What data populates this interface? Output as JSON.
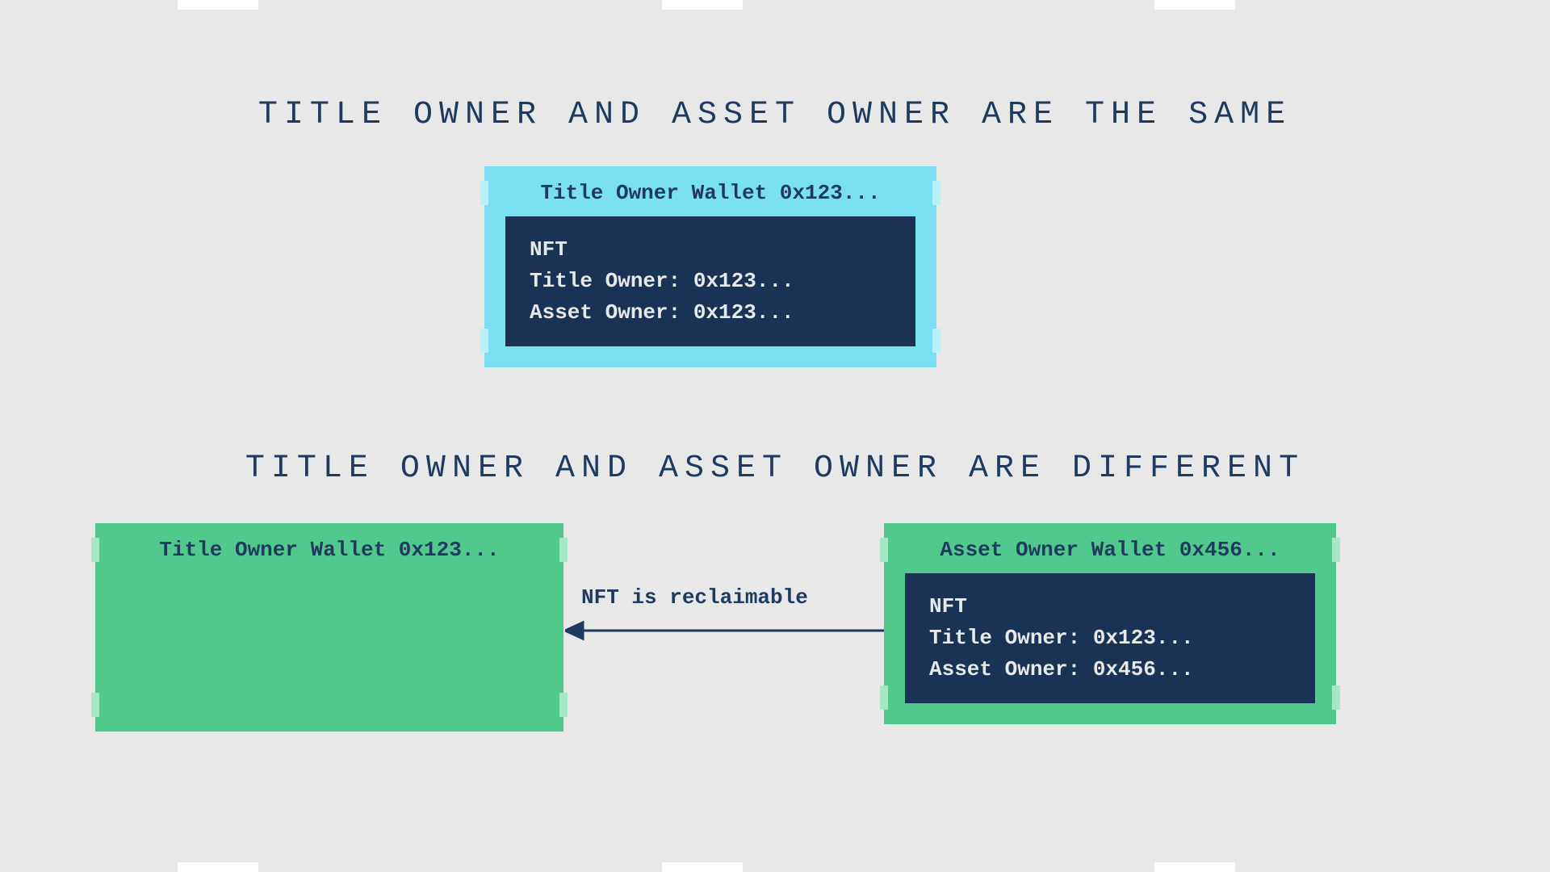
{
  "section1": {
    "heading": "TITLE OWNER AND ASSET OWNER ARE THE SAME",
    "wallet": {
      "label": "Title Owner Wallet 0x123...",
      "bg": "#7bdff2",
      "tick": "#b8f0fa",
      "nft": {
        "title": "NFT",
        "line1": "Title Owner: 0x123...",
        "line2": "Asset Owner: 0x123..."
      }
    }
  },
  "section2": {
    "heading": "TITLE OWNER AND ASSET OWNER ARE DIFFERENT",
    "walletLeft": {
      "label": "Title Owner Wallet 0x123...",
      "bg": "#52c98c",
      "tick": "#a6e8c5"
    },
    "walletRight": {
      "label": "Asset Owner Wallet 0x456...",
      "bg": "#52c98c",
      "tick": "#a6e8c5",
      "nft": {
        "title": "NFT",
        "line1": "Title Owner: 0x123...",
        "line2": "Asset Owner: 0x456..."
      }
    },
    "arrow": {
      "label": "NFT is reclaimable"
    }
  }
}
